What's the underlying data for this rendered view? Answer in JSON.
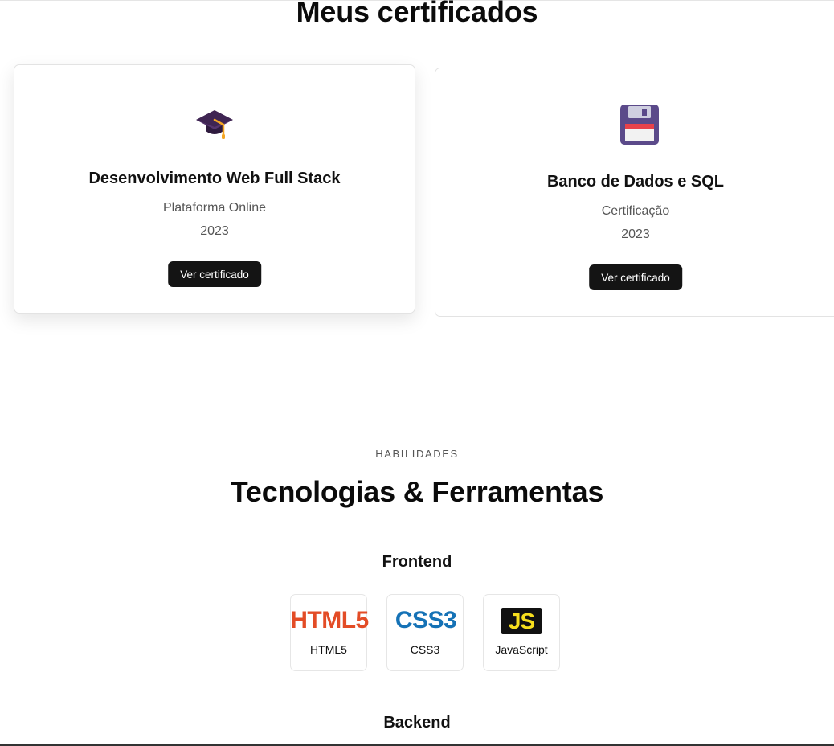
{
  "certificates": {
    "title": "Meus certificados",
    "cards": [
      {
        "icon": "graduation-cap-icon",
        "title": "Desenvolvimento Web Full Stack",
        "issuer": "Plataforma Online",
        "year": "2023",
        "button_label": "Ver certificado"
      },
      {
        "icon": "floppy-disk-icon",
        "title": "Banco de Dados e SQL",
        "issuer": "Certificação",
        "year": "2023",
        "button_label": "Ver certificado"
      }
    ]
  },
  "skills": {
    "eyebrow": "HABILIDADES",
    "title": "Tecnologias & Ferramentas",
    "groups": [
      {
        "title": "Frontend",
        "items": [
          {
            "logo_text": "HTML5",
            "label": "HTML5",
            "color": "#e34c26"
          },
          {
            "logo_text": "CSS3",
            "label": "CSS3",
            "color": "#1572b6"
          },
          {
            "logo_text": "JS",
            "label": "JavaScript",
            "color": "#f7df1e"
          }
        ]
      },
      {
        "title": "Backend"
      }
    ]
  },
  "colors": {
    "button_bg": "#141414",
    "graduation_cap": "#3f2553",
    "tassel": "#f5a623",
    "floppy_body": "#5b4a8a",
    "floppy_label": "#e8424a"
  }
}
